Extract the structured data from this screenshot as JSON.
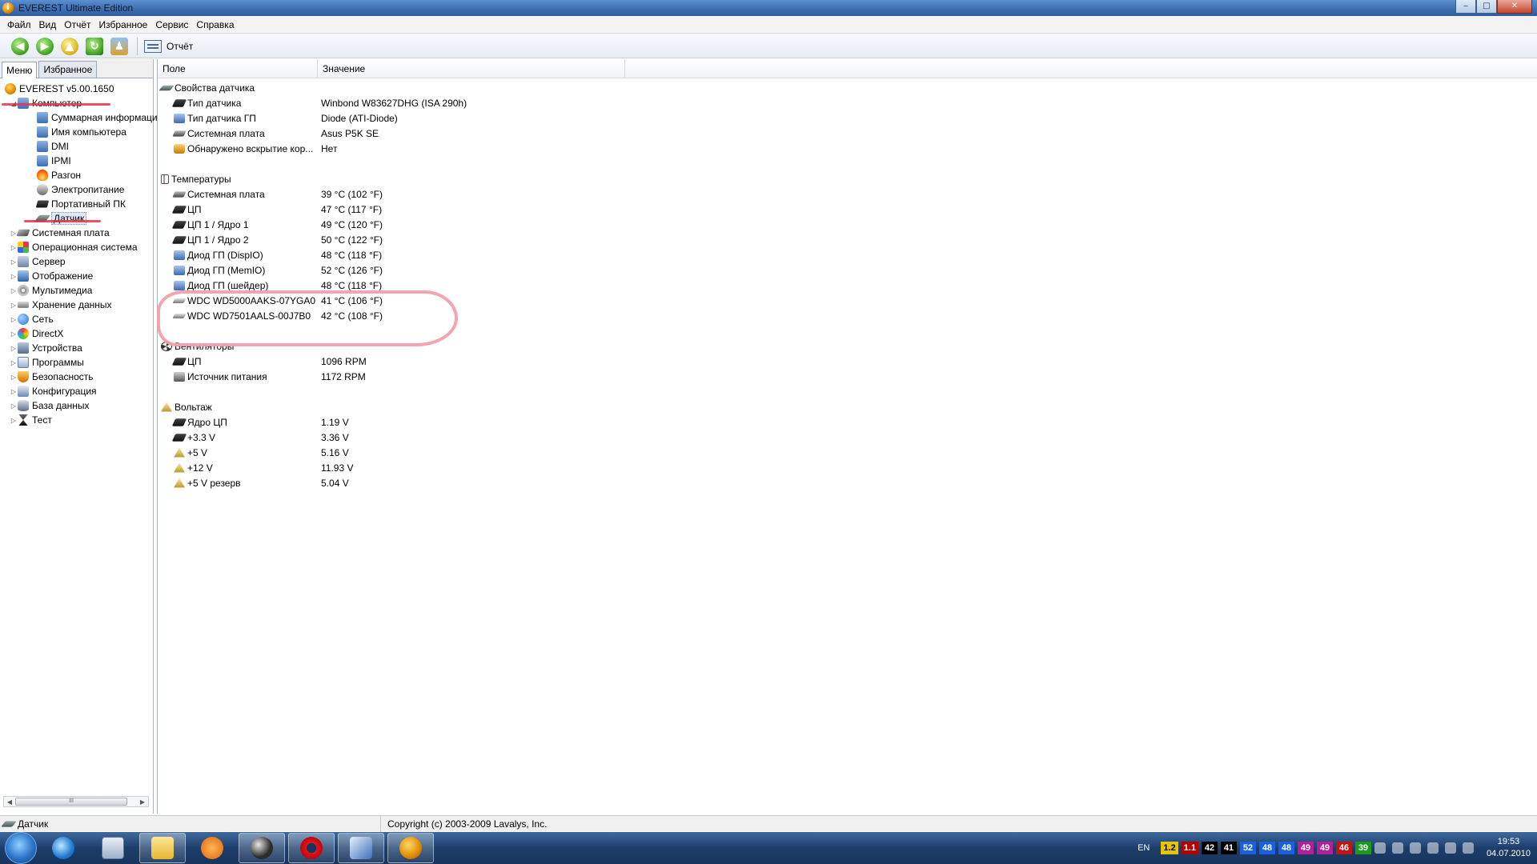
{
  "window": {
    "title": "EVEREST Ultimate Edition",
    "btn_min": "‒",
    "btn_max": "□",
    "btn_close": "✕"
  },
  "menu": [
    "Файл",
    "Вид",
    "Отчёт",
    "Избранное",
    "Сервис",
    "Справка"
  ],
  "toolbar": {
    "report_label": "Отчёт"
  },
  "left": {
    "tabs": [
      "Меню",
      "Избранное"
    ],
    "root": "EVEREST v5.00.1650",
    "computer": "Компьютер",
    "computer_children": [
      {
        "label": "Суммарная информация",
        "icon": "pc"
      },
      {
        "label": "Имя компьютера",
        "icon": "pc"
      },
      {
        "label": "DMI",
        "icon": "pc"
      },
      {
        "label": "IPMI",
        "icon": "pc"
      },
      {
        "label": "Разгон",
        "icon": "flame"
      },
      {
        "label": "Электропитание",
        "icon": "power"
      },
      {
        "label": "Портативный ПК",
        "icon": "laptop"
      },
      {
        "label": "Датчик",
        "icon": "sensor"
      }
    ],
    "top_items": [
      {
        "label": "Системная плата",
        "icon": "board"
      },
      {
        "label": "Операционная система",
        "icon": "os"
      },
      {
        "label": "Сервер",
        "icon": "srv"
      },
      {
        "label": "Отображение",
        "icon": "mon"
      },
      {
        "label": "Мультимедиа",
        "icon": "media"
      },
      {
        "label": "Хранение данных",
        "icon": "hdd"
      },
      {
        "label": "Сеть",
        "icon": "net"
      },
      {
        "label": "DirectX",
        "icon": "dx"
      },
      {
        "label": "Устройства",
        "icon": "dev"
      },
      {
        "label": "Программы",
        "icon": "prog"
      },
      {
        "label": "Безопасность",
        "icon": "sec"
      },
      {
        "label": "Конфигурация",
        "icon": "cfg"
      },
      {
        "label": "База данных",
        "icon": "db"
      },
      {
        "label": "Тест",
        "icon": "test"
      }
    ]
  },
  "right": {
    "columns": [
      "Поле",
      "Значение"
    ],
    "groups": [
      {
        "title": "Свойства датчика",
        "icon": "sensor",
        "rows": [
          {
            "field": "Тип датчика",
            "value": "Winbond W83627DHG  (ISA 290h)",
            "icon": "chip"
          },
          {
            "field": "Тип датчика ГП",
            "value": "Diode  (ATI-Diode)",
            "icon": "gpu"
          },
          {
            "field": "Системная плата",
            "value": "Asus P5K SE",
            "icon": "board"
          },
          {
            "field": "Обнаружено вскрытие кор...",
            "value": "Нет",
            "icon": "lock"
          }
        ]
      },
      {
        "title": "Температуры",
        "icon": "thermo",
        "rows": [
          {
            "field": "Системная плата",
            "value": "39 °C  (102 °F)",
            "icon": "board"
          },
          {
            "field": "ЦП",
            "value": "47 °C  (117 °F)",
            "icon": "chip"
          },
          {
            "field": "ЦП 1 / Ядро 1",
            "value": "49 °C  (120 °F)",
            "icon": "chip"
          },
          {
            "field": "ЦП 1 / Ядро 2",
            "value": "50 °C  (122 °F)",
            "icon": "chip"
          },
          {
            "field": "Диод ГП (DispIO)",
            "value": "48 °C  (118 °F)",
            "icon": "gpu"
          },
          {
            "field": "Диод ГП (MemIO)",
            "value": "52 °C  (126 °F)",
            "icon": "gpu"
          },
          {
            "field": "Диод ГП (шейдер)",
            "value": "48 °C  (118 °F)",
            "icon": "gpu"
          },
          {
            "field": "WDC WD5000AAKS-07YGA0",
            "value": "41 °C  (106 °F)",
            "icon": "hdd"
          },
          {
            "field": "WDC WD7501AALS-00J7B0",
            "value": "42 °C  (108 °F)",
            "icon": "hdd"
          }
        ]
      },
      {
        "title": "Вентиляторы",
        "icon": "fan",
        "rows": [
          {
            "field": "ЦП",
            "value": "1096 RPM",
            "icon": "chip"
          },
          {
            "field": "Источник питания",
            "value": "1172 RPM",
            "icon": "psu"
          }
        ]
      },
      {
        "title": "Вольтаж",
        "icon": "warn",
        "rows": [
          {
            "field": "Ядро ЦП",
            "value": "1.19 V",
            "icon": "chip"
          },
          {
            "field": "+3.3 V",
            "value": "3.36 V",
            "icon": "chip"
          },
          {
            "field": "+5 V",
            "value": "5.16 V",
            "icon": "warn"
          },
          {
            "field": "+12 V",
            "value": "11.93 V",
            "icon": "warn"
          },
          {
            "field": "+5 V резерв",
            "value": "5.04 V",
            "icon": "warn"
          }
        ]
      }
    ]
  },
  "status": {
    "left": "Датчик",
    "right": "Copyright (c) 2003-2009 Lavalys, Inc."
  },
  "taskbar": {
    "lang": "EN",
    "temps": [
      {
        "v": "1.2",
        "bg": "#e8c400",
        "fg": "#000000"
      },
      {
        "v": "1.1",
        "bg": "#b00000",
        "fg": "#ffffff"
      },
      {
        "v": "42",
        "bg": "#000000",
        "fg": "#ffffff"
      },
      {
        "v": "41",
        "bg": "#000000",
        "fg": "#ffffff"
      },
      {
        "v": "52",
        "bg": "#1a5fe0",
        "fg": "#ffffff"
      },
      {
        "v": "48",
        "bg": "#1a5fe0",
        "fg": "#ffffff"
      },
      {
        "v": "48",
        "bg": "#1a5fe0",
        "fg": "#ffffff"
      },
      {
        "v": "49",
        "bg": "#b0209a",
        "fg": "#ffffff"
      },
      {
        "v": "49",
        "bg": "#b0209a",
        "fg": "#ffffff"
      },
      {
        "v": "46",
        "bg": "#c01515",
        "fg": "#ffffff"
      },
      {
        "v": "39",
        "bg": "#1c9a1c",
        "fg": "#ffffff"
      }
    ],
    "time": "19:53",
    "date": "04.07.2010"
  }
}
